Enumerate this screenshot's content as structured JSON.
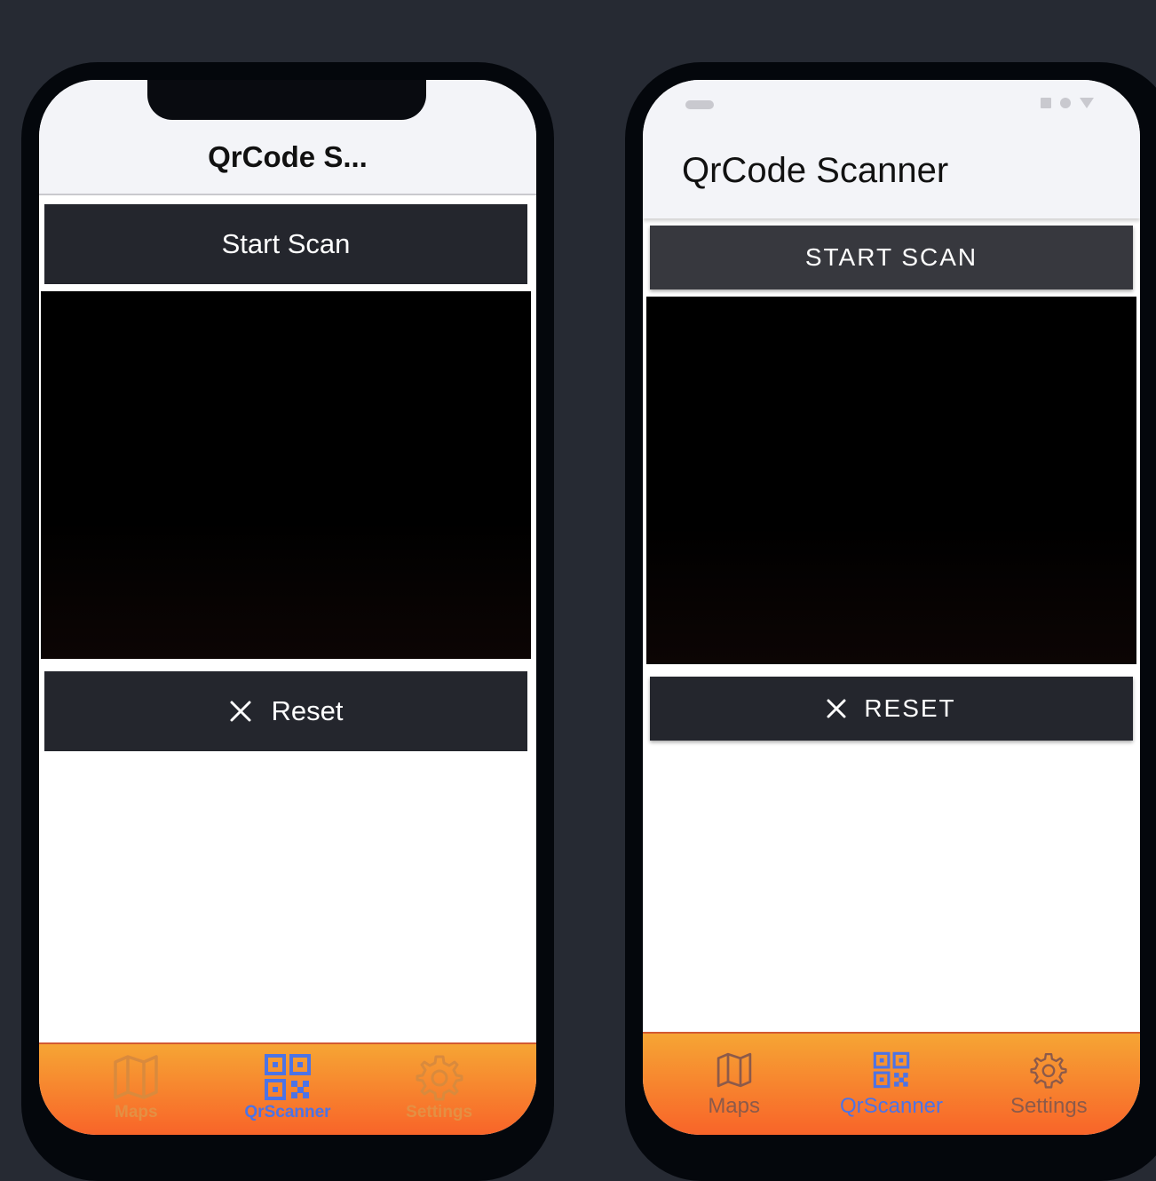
{
  "ios": {
    "header_title": "QrCode S...",
    "start_button_label": "Start Scan",
    "reset_button_label": "Reset",
    "tabs": [
      {
        "label": "Maps",
        "icon": "map-icon",
        "active": false
      },
      {
        "label": "QrScanner",
        "icon": "qrcode-icon",
        "active": true
      },
      {
        "label": "Settings",
        "icon": "gear-icon",
        "active": false
      }
    ]
  },
  "android": {
    "header_title": "QrCode Scanner",
    "start_button_label": "START SCAN",
    "reset_button_label": "RESET",
    "tabs": [
      {
        "label": "Maps",
        "icon": "map-icon",
        "active": false
      },
      {
        "label": "QrScanner",
        "icon": "qrcode-icon",
        "active": true
      },
      {
        "label": "Settings",
        "icon": "gear-icon",
        "active": false
      }
    ]
  },
  "colors": {
    "button_bg": "#24262d",
    "tab_gradient_top": "#f6a534",
    "tab_gradient_bottom": "#f86429",
    "active_tab": "#4c73e6",
    "page_bg": "#262a33"
  }
}
